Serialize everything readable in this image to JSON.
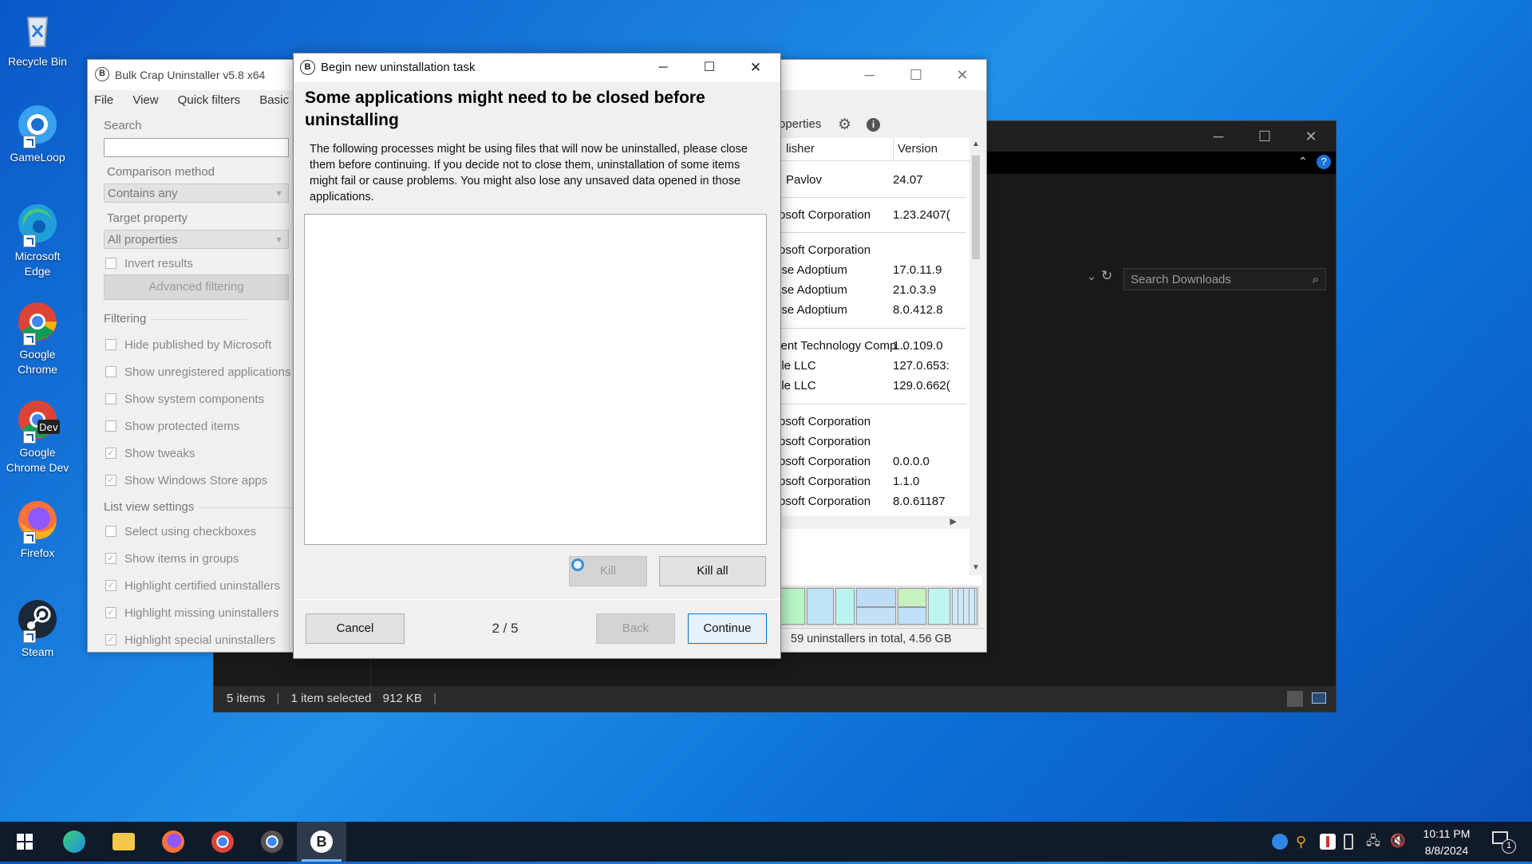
{
  "desktop": {
    "icons": [
      {
        "label": "Recycle Bin"
      },
      {
        "label": "GameLoop"
      },
      {
        "label": "Microsoft Edge"
      },
      {
        "label": "Google Chrome"
      },
      {
        "label": "Google Chrome Dev"
      },
      {
        "label": "Firefox"
      },
      {
        "label": "Steam"
      }
    ]
  },
  "explorer": {
    "search_placeholder": "Search Downloads",
    "status": {
      "items": "5 items",
      "selected": "1 item selected",
      "size": "912 KB"
    }
  },
  "bcu": {
    "title": "Bulk Crap Uninstaller v5.8 x64",
    "menu": [
      "File",
      "View",
      "Quick filters",
      "Basic"
    ],
    "toolbar_properties": "roperties",
    "search_label": "Search",
    "comparison_label": "Comparison method",
    "comparison_value": "Contains any",
    "target_label": "Target property",
    "target_value": "All properties",
    "invert_label": "Invert results",
    "advanced_button": "Advanced filtering",
    "filtering_group": "Filtering",
    "filtering_options": [
      "Hide published by Microsoft",
      "Show unregistered applications",
      "Show system components",
      "Show protected items",
      "Show tweaks",
      "Show Windows Store apps"
    ],
    "listview_group": "List view settings",
    "listview_options": [
      "Select using checkboxes",
      "Show items in groups",
      "Highlight certified uninstallers",
      "Highlight missing uninstallers",
      "Highlight special uninstallers"
    ],
    "columns": {
      "publisher": "lisher",
      "version": "Version"
    },
    "rows": [
      {
        "publisher": "Pavlov",
        "version": "24.07"
      },
      {
        "publisher": "rosoft Corporation",
        "version": "1.23.2407("
      },
      {
        "publisher": "rosoft Corporation",
        "version": ""
      },
      {
        "publisher": "ose Adoptium",
        "version": "17.0.11.9"
      },
      {
        "publisher": "ose Adoptium",
        "version": "21.0.3.9"
      },
      {
        "publisher": "ose Adoptium",
        "version": "8.0.412.8"
      },
      {
        "publisher": "cent Technology Comp...",
        "version": "1.0.109.0"
      },
      {
        "publisher": "gle LLC",
        "version": "127.0.653:"
      },
      {
        "publisher": "gle LLC",
        "version": "129.0.662("
      },
      {
        "publisher": "rosoft Corporation",
        "version": ""
      },
      {
        "publisher": "rosoft Corporation",
        "version": ""
      },
      {
        "publisher": "rosoft Corporation",
        "version": "0.0.0.0"
      },
      {
        "publisher": "rosoft Corporation",
        "version": "1.1.0"
      },
      {
        "publisher": "rosoft Corporation",
        "version": "8.0.61187"
      }
    ],
    "status_total": "59 uninstallers in total, 4.56 GB"
  },
  "dialog": {
    "title": "Begin new uninstallation task",
    "heading": "Some applications might need to be closed before uninstalling",
    "description": "The following processes might be using files that will now be uninstalled, please close them before continuing. If you decide not to close them, uninstallation of some items might fail or cause problems. You might also lose any unsaved data opened in those applications.",
    "kill_button": "Kill",
    "kill_all_button": "Kill all",
    "cancel_button": "Cancel",
    "step": "2 / 5",
    "back_button": "Back",
    "continue_button": "Continue"
  },
  "taskbar": {
    "time": "10:11 PM",
    "date": "8/8/2024",
    "notification_count": "1"
  },
  "colors": {
    "desktop": "#1578d8",
    "taskbar": "#101a28",
    "accent": "#0078d7"
  }
}
